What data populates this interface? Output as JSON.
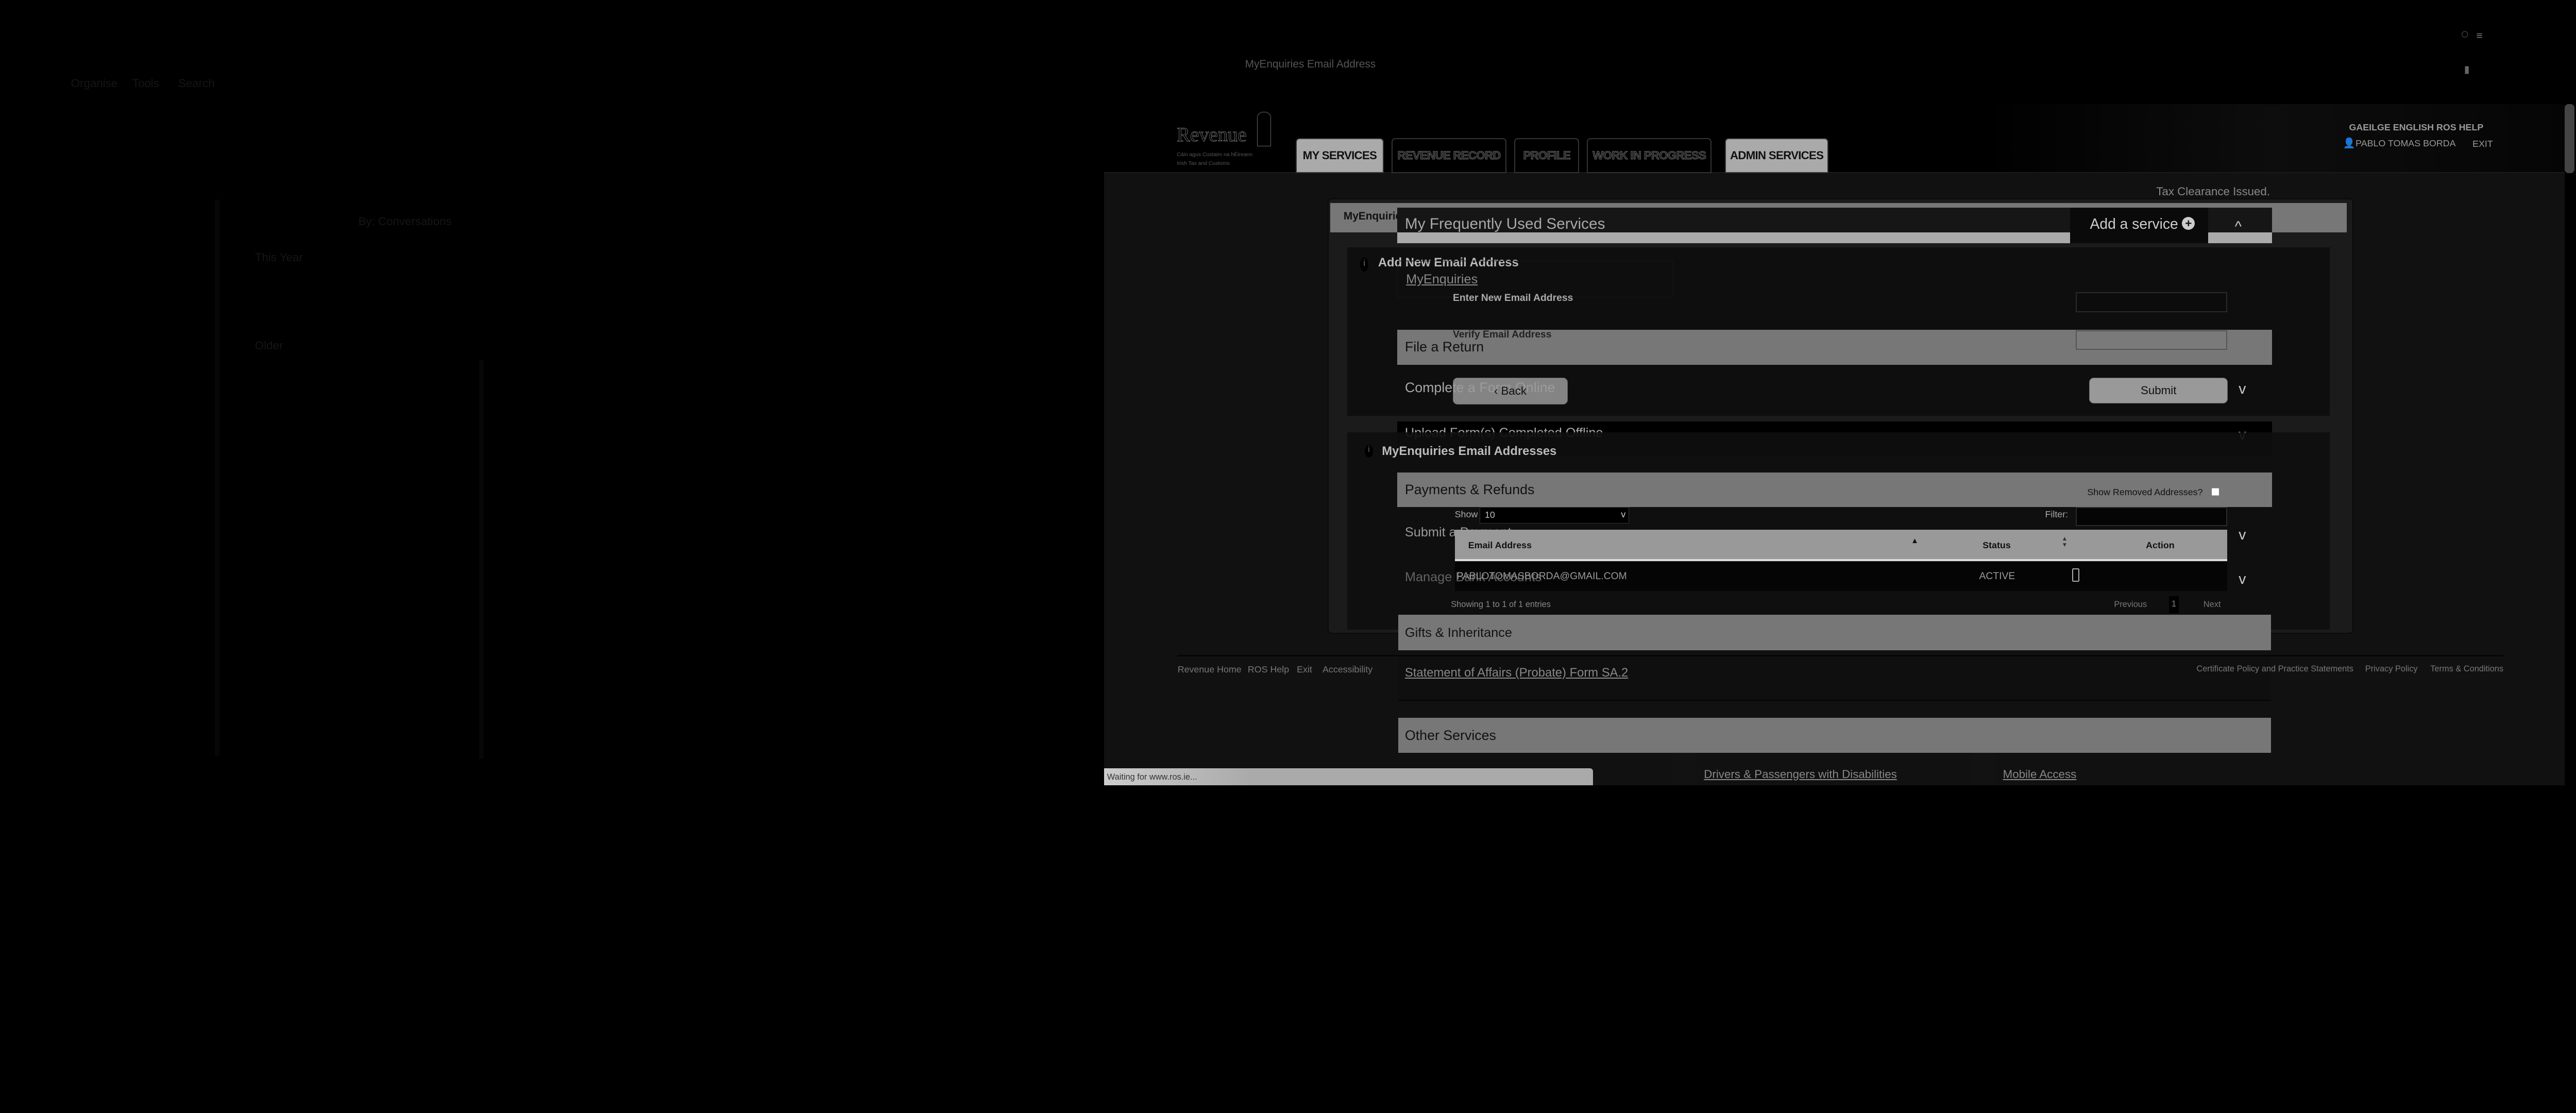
{
  "left_app": {
    "menu": [
      "Organise",
      "Tools",
      "Search"
    ],
    "sort_label": "By: Conversations",
    "groups": [
      "This Year",
      "Older"
    ]
  },
  "browser": {
    "window_title": "MyEnquiries Email Address",
    "status_text": "Waiting for www.ros.ie..."
  },
  "header": {
    "logo_text": "Revenue",
    "logo_sub1": "Cáin agus Custaim na hÉireann",
    "logo_sub2": "Irish Tax and Customs",
    "tabs": [
      {
        "label": "MY SERVICES",
        "active": true
      },
      {
        "label": "REVENUE RECORD",
        "active": false
      },
      {
        "label": "PROFILE",
        "active": false
      },
      {
        "label": "WORK IN PROGRESS",
        "active": false
      },
      {
        "label": "ADMIN SERVICES",
        "active": true
      }
    ],
    "lang_links": "GAEILGE  ENGLISH  ROS HELP",
    "user_name": "PABLO TOMAS BORDA",
    "exit_label": "EXIT"
  },
  "main": {
    "tax_clearance": "Tax Clearance Issued.",
    "myenquiries_bar": "MyEnquiries",
    "frequent_services": "My Frequently Used Services",
    "add_service": "Add a service",
    "add_email": {
      "title": "Add New Email Address",
      "link": "MyEnquiries",
      "enter_label": "Enter New Email Address",
      "enter_value": "",
      "verify_label": "Verify Email Address",
      "verify_value": "",
      "back_label": "Back",
      "submit_label": "Submit"
    },
    "sections": {
      "file_return": "File a Return",
      "complete_online": "Complete a Form Online",
      "upload_offline": "Upload Form(s) Completed Offline",
      "payments": "Payments & Refunds",
      "submit_payment": "Submit a Payment",
      "manage_bank": "Manage Bank Accounts",
      "gifts": "Gifts & Inheritance",
      "statement": "Statement of Affairs (Probate) Form SA.2",
      "other": "Other Services",
      "drivers": "Drivers & Passengers with Disabilities",
      "mobile": "Mobile Access"
    },
    "email_table": {
      "title": "MyEnquiries Email Addresses",
      "show_removed": "Show Removed Addresses?",
      "show_label": "Show",
      "show_value": "10",
      "filter_label": "Filter:",
      "columns": [
        "Email Address",
        "Status",
        "Action"
      ],
      "rows": [
        {
          "email": "PABLOTOMASBORDA@GMAIL.COM",
          "status": "ACTIVE"
        }
      ],
      "info": "Showing 1 to 1 of 1 entries",
      "prev": "Previous",
      "page": "1",
      "next": "Next"
    }
  },
  "footer": {
    "left": [
      "Revenue Home",
      "ROS Help",
      "Exit",
      "Accessibility"
    ],
    "right": [
      "Certificate Policy and Practice Statements",
      "Privacy Policy",
      "Terms & Conditions"
    ]
  }
}
